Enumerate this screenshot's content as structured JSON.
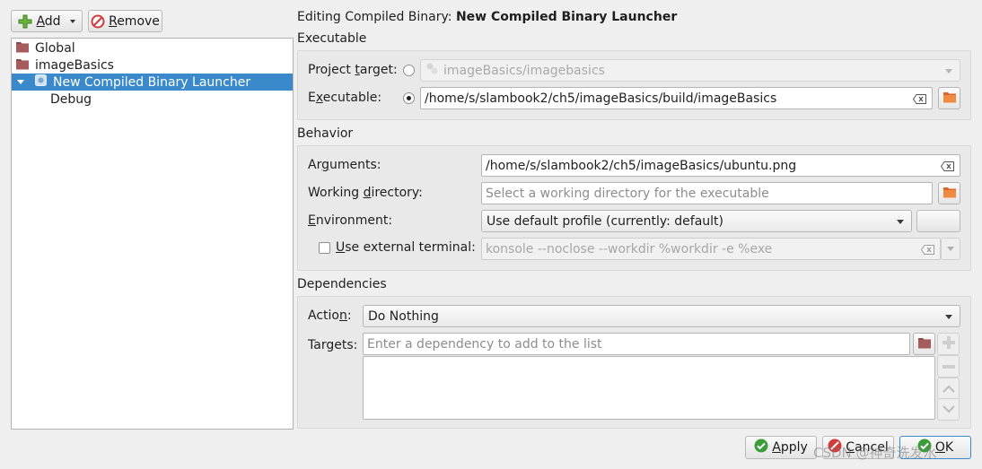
{
  "toolbar": {
    "add": {
      "pre": "",
      "mn": "A",
      "post": "dd"
    },
    "remove": {
      "pre": "",
      "mn": "R",
      "post": "emove"
    }
  },
  "tree": {
    "items": [
      {
        "label": "Global"
      },
      {
        "label": "imageBasics"
      },
      {
        "label": "New Compiled Binary Launcher"
      },
      {
        "label": "Debug"
      }
    ]
  },
  "header": {
    "prefix": "Editing Compiled Binary: ",
    "name": "New Compiled Binary Launcher"
  },
  "executable": {
    "title": "Executable",
    "project_target": {
      "pre": "Project ",
      "mn": "t",
      "post": "arget:"
    },
    "project_target_value": "imageBasics/imagebasics",
    "executable_label": {
      "pre": "E",
      "mn": "x",
      "post": "ecutable:"
    },
    "executable_value": "/home/s/slambook2/ch5/imageBasics/build/imageBasics"
  },
  "behavior": {
    "title": "Behavior",
    "arguments": {
      "pre": "Ar",
      "mn": "g",
      "post": "uments:"
    },
    "arguments_value": "/home/s/slambook2/ch5/imageBasics/ubuntu.png",
    "workdir": {
      "pre": "Working ",
      "mn": "d",
      "post": "irectory:"
    },
    "workdir_placeholder": "Select a working directory for the executable",
    "environment": {
      "pre": "",
      "mn": "E",
      "post": "nvironment:"
    },
    "environment_value": "Use default profile (currently: default)",
    "external_terminal": {
      "pre": "",
      "mn": "U",
      "post": "se external terminal:"
    },
    "terminal_value": "konsole --noclose --workdir %workdir -e %exe"
  },
  "dependencies": {
    "title": "Dependencies",
    "action": {
      "pre": "Actio",
      "mn": "n",
      "post": ":"
    },
    "action_value": "Do Nothing",
    "targets_label": "Targets:",
    "targets_placeholder": "Enter a dependency to add to the list"
  },
  "footer": {
    "apply": {
      "pre": "",
      "mn": "A",
      "post": "pply"
    },
    "cancel": {
      "pre": "",
      "mn": "C",
      "post": "ancel"
    },
    "ok": {
      "pre": "",
      "mn": "O",
      "post": "K"
    }
  },
  "watermark": "CSDN @神奇洗发水",
  "colors": {
    "accent": "#3a89cb",
    "add_green": "#5aa63a",
    "remove_red": "#d23b3b"
  }
}
